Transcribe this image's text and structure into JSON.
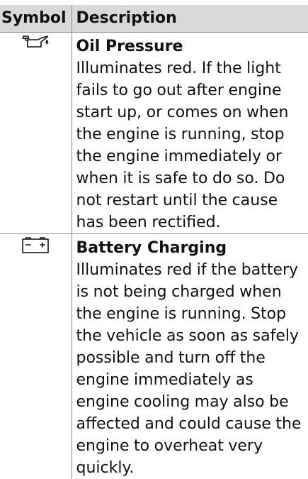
{
  "table": {
    "header": {
      "symbol": "Symbol",
      "description": "Description"
    },
    "rows": [
      {
        "icon": "oil-can-icon",
        "title": "Oil Pressure",
        "text": "Illuminates red. If the light fails to go out after engine start up, or comes on when the engine is running, stop the engine immediately or when it is safe to do so. Do not restart until the cause has been rectified."
      },
      {
        "icon": "battery-icon",
        "title": "Battery Charging",
        "text": "Illuminates red if the battery is not being charged when the engine is running. Stop the vehicle as soon as safely possible and turn off the engine immediately as engine cooling may also be affected and could cause the engine to overheat very quickly."
      }
    ]
  }
}
